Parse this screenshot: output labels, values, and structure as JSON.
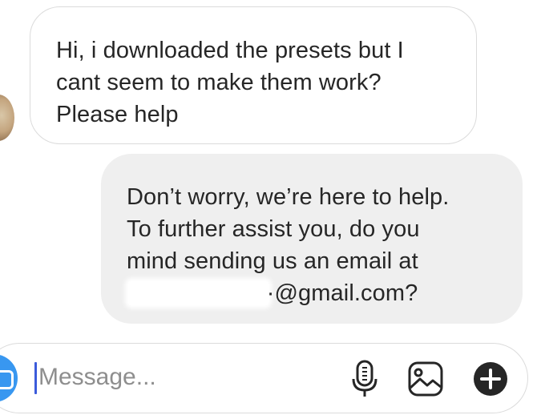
{
  "messages": {
    "incoming": {
      "lines": [
        "Hi, i downloaded the presets but I",
        "cant seem to make them work?",
        "Please help"
      ]
    },
    "outgoing": {
      "lines": [
        "Don’t worry, we’re here to help.",
        "To further assist you, do you",
        "mind sending us an email at"
      ],
      "email_prefix": "·",
      "email_partial": "·@gmail.com?"
    }
  },
  "composer": {
    "placeholder": "Message...",
    "value": ""
  },
  "icons": {
    "camera": "camera-icon",
    "mic": "microphone-icon",
    "photo": "photo-gallery-icon",
    "plus": "plus-circle-icon"
  },
  "colors": {
    "accent": "#3897f0",
    "outgoing_bubble": "#efefef",
    "incoming_border": "#dbdbdb",
    "text": "#262626",
    "placeholder": "#8e8e8e"
  }
}
